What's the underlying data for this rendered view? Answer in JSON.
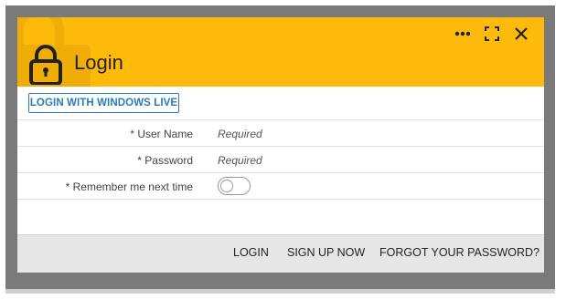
{
  "dialog": {
    "title": "Login",
    "header_color": "#fdba0b",
    "header_icons": [
      "more-icon",
      "expand-icon",
      "close-icon"
    ],
    "title_icon": "lock-icon"
  },
  "windows_live_button": {
    "label": "LOGIN WITH WINDOWS LIVE"
  },
  "form": {
    "username": {
      "label": "* User Name",
      "placeholder": "Required",
      "value": ""
    },
    "password": {
      "label": "* Password",
      "placeholder": "Required",
      "value": ""
    },
    "remember": {
      "label": "* Remember me next time",
      "checked": false
    }
  },
  "footer": {
    "login_label": "LOGIN",
    "signup_label": "SIGN UP NOW",
    "forgot_label": "FORGOT YOUR PASSWORD?"
  }
}
